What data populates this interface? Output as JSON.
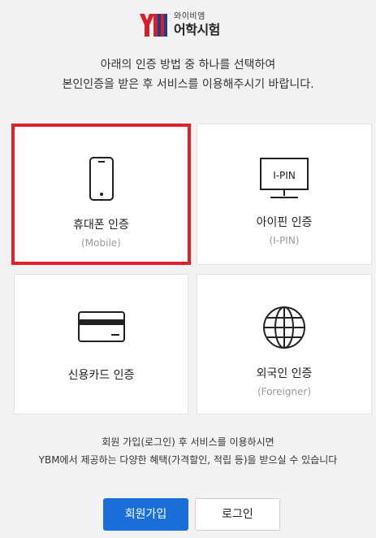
{
  "logo": {
    "top_text": "와이비엠",
    "bottom_text": "어학시험",
    "mark_text": "YBM"
  },
  "intro": {
    "line1": "아래의 인증 방법 중 하나를 선택하여",
    "line2": "본인인증을 받은 후 서비스를 이용해주시기 바랍니다."
  },
  "methods": [
    {
      "label": "휴대폰 인증",
      "sub": "(Mobile)",
      "icon": "mobile-phone-icon",
      "selected": true
    },
    {
      "label": "아이핀 인증",
      "sub": "(I-PIN)",
      "icon": "ipin-monitor-icon",
      "icon_text": "I-PIN",
      "selected": false
    },
    {
      "label": "신용카드 인증",
      "sub": "",
      "icon": "credit-card-icon",
      "selected": false
    },
    {
      "label": "외국인 인증",
      "sub": "(Foreigner)",
      "icon": "globe-icon",
      "selected": false
    }
  ],
  "notice": {
    "line1": "회원 가입(로그인) 후 서비스를 이용하시면",
    "line2": "YBM에서 제공하는 다양한 혜택(가격할인, 적립 등)을 받으실 수 있습니다"
  },
  "buttons": {
    "signup": "회원가입",
    "login": "로그인"
  },
  "colors": {
    "selected_border": "#e0202a",
    "primary_button": "#1b6fd8",
    "brand_red": "#d61f2b"
  }
}
